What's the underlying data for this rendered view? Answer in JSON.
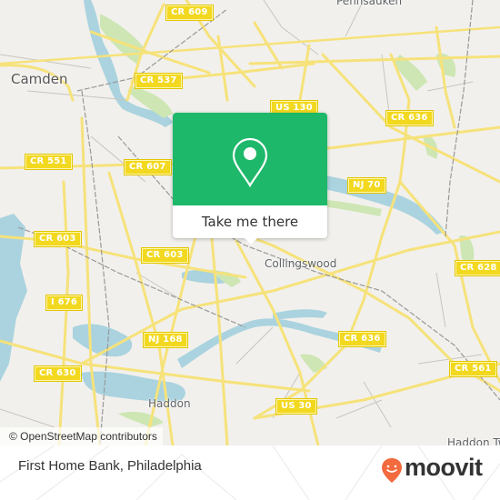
{
  "map": {
    "colors": {
      "land": "#f2f0ec",
      "water": "#aad3df",
      "park": "#cde6b4",
      "road_major": "#f6e27a",
      "road_minor": "#c8c5c0",
      "rail": "#888888",
      "shield": "#f2d81f"
    },
    "places": [
      {
        "name": "Camden",
        "size": "big"
      },
      {
        "name": "Pennsauken",
        "size": "med"
      },
      {
        "name": "Collingswood",
        "size": "med"
      },
      {
        "name": "Haddon",
        "size": "med"
      },
      {
        "name": "Haddon Tw",
        "size": "med"
      }
    ],
    "road_labels": [
      "CR 609",
      "CR 537",
      "US 130",
      "CR 636",
      "CR 551",
      "CR 607",
      "NJ 70",
      "CR 603",
      "CR 603",
      "CR 628",
      "I 676",
      "NJ 168",
      "CR 636",
      "CR 630",
      "CR 561",
      "US 30"
    ]
  },
  "popup": {
    "icon": "location-pin-icon",
    "action_label": "Take me there",
    "accent_color": "#1db86a"
  },
  "attribution": "© OpenStreetMap contributors",
  "footer": {
    "title": "First Home Bank, Philadelphia",
    "brand": "moovit",
    "brand_color": "#f26a3d"
  }
}
